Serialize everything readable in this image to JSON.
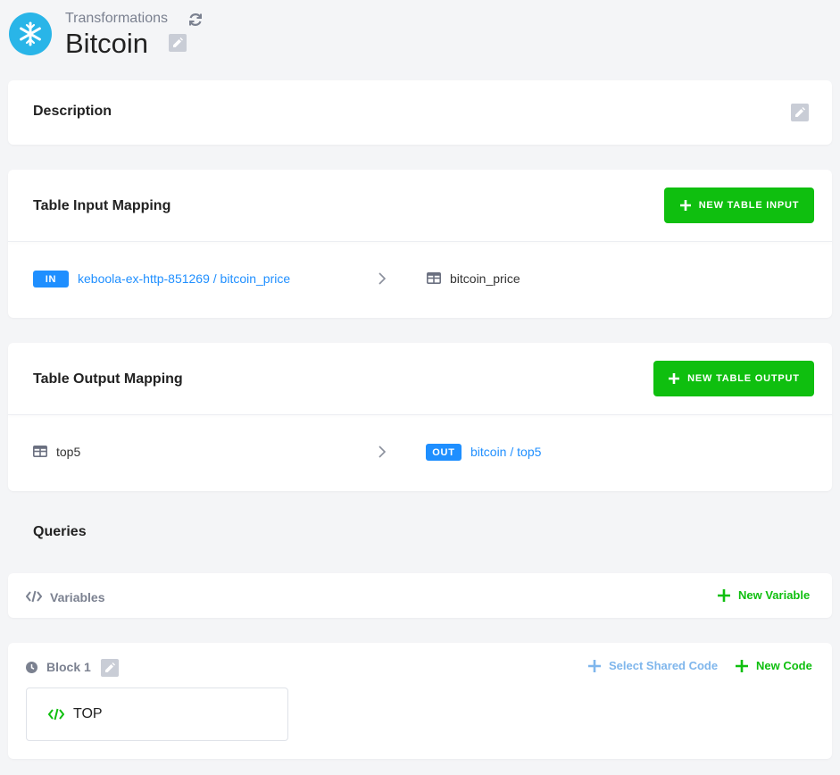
{
  "header": {
    "breadcrumb": "Transformations",
    "title": "Bitcoin",
    "logo_icon": "snowflake-icon",
    "colors": {
      "logo": "#29b5e8"
    }
  },
  "description": {
    "title": "Description"
  },
  "input_mapping": {
    "title": "Table Input Mapping",
    "button_label": "NEW TABLE INPUT",
    "rows": [
      {
        "badge": "IN",
        "source": "keboola-ex-http-851269 / bitcoin_price",
        "destination": "bitcoin_price"
      }
    ]
  },
  "output_mapping": {
    "title": "Table Output Mapping",
    "button_label": "NEW TABLE OUTPUT",
    "rows": [
      {
        "source": "top5",
        "badge": "OUT",
        "destination": "bitcoin / top5"
      }
    ]
  },
  "queries": {
    "title": "Queries",
    "variables_label": "Variables",
    "new_variable_label": "New Variable",
    "blocks": [
      {
        "name": "Block 1",
        "select_shared_code_label": "Select Shared Code",
        "new_code_label": "New Code",
        "codes": [
          {
            "name": "TOP"
          }
        ]
      }
    ]
  },
  "colors": {
    "accent_green": "#0fbf0f",
    "accent_blue": "#1f8fff",
    "background": "#f4f5f7"
  }
}
